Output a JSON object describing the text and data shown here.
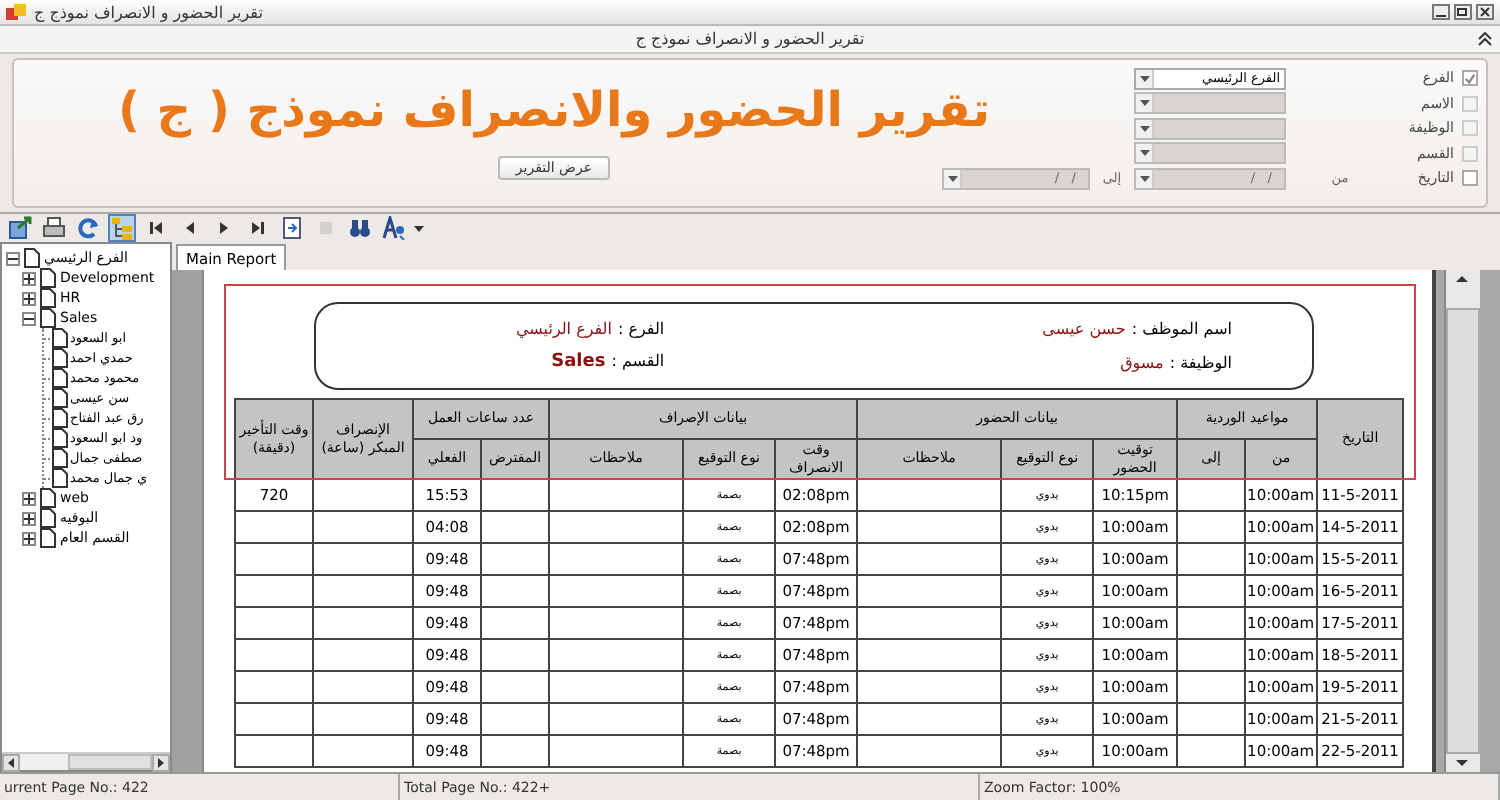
{
  "window": {
    "title": "تقرير الحضور و الانصراف نموذج ج"
  },
  "panel": {
    "title": "تقرير الحضور و الانصراف نموذج ج"
  },
  "banner": "تقرير الحضور والانصراف نموذج ( ج )",
  "filters": [
    {
      "label": "الفرع",
      "checked": true,
      "disabled": false,
      "value": "الفرع الرئيسي"
    },
    {
      "label": "الاسم",
      "checked": false,
      "disabled": true
    },
    {
      "label": "الوظيفة",
      "checked": false,
      "disabled": true
    },
    {
      "label": "القسم",
      "checked": false,
      "disabled": true
    }
  ],
  "date_filter": {
    "label": "التاريخ",
    "checked": false,
    "from_label": "من",
    "from_value": "/   /",
    "to_label": "إلى",
    "to_value": "/   /"
  },
  "show_button": "عرض التقرير",
  "toolbar": [
    {
      "kind": "export",
      "selected": false,
      "disabled": false
    },
    {
      "kind": "print",
      "selected": false,
      "disabled": false
    },
    {
      "kind": "refresh",
      "selected": false,
      "disabled": false
    },
    {
      "kind": "tree",
      "selected": true,
      "disabled": false
    },
    {
      "kind": "first",
      "selected": false,
      "disabled": false
    },
    {
      "kind": "prev",
      "selected": false,
      "disabled": false
    },
    {
      "kind": "next",
      "selected": false,
      "disabled": false
    },
    {
      "kind": "last",
      "selected": false,
      "disabled": false
    },
    {
      "kind": "goto",
      "selected": false,
      "disabled": false
    },
    {
      "kind": "stop",
      "selected": false,
      "disabled": true
    },
    {
      "kind": "search",
      "selected": false,
      "disabled": false
    },
    {
      "kind": "find",
      "selected": false,
      "disabled": false
    }
  ],
  "tree": [
    {
      "label": "الفرع الرئيسي",
      "expanded": true,
      "children": [
        {
          "label": "Development",
          "expanded": false
        },
        {
          "label": "HR",
          "expanded": false
        },
        {
          "label": "Sales",
          "expanded": true,
          "children": [
            {
              "label": "ابو السعود"
            },
            {
              "label": "حمدي احمد"
            },
            {
              "label": "محمود محمد"
            },
            {
              "label": "سن عيسى"
            },
            {
              "label": "رق عبد الفتاح"
            },
            {
              "label": "ود ابو السعود"
            },
            {
              "label": "صطفى جمال"
            },
            {
              "label": "ي جمال محمد"
            }
          ]
        },
        {
          "label": "web",
          "expanded": false
        },
        {
          "label": "البوفيه",
          "expanded": false
        },
        {
          "label": "القسم العام",
          "expanded": false
        }
      ]
    }
  ],
  "tabs": [
    {
      "label": "Main Report",
      "selected": true
    }
  ],
  "report": {
    "info_right": [
      {
        "label": "اسم الموظف :",
        "value": "حسن عيسى"
      },
      {
        "label": "الوظيفة :",
        "value": "مسوق"
      }
    ],
    "info_left": [
      {
        "label": "الفرع :",
        "value": "الفرع الرئيسي"
      },
      {
        "label": "القسم :",
        "value": "Sales"
      }
    ],
    "headers": [
      {
        "label": "التاريخ"
      },
      {
        "label": "مواعيد الوردية",
        "sub": [
          "من",
          "إلى"
        ]
      },
      {
        "label": "بيانات الحضور",
        "sub": [
          "توقيت الحضور",
          "نوع التوقيع",
          "ملاحظات"
        ]
      },
      {
        "label": "بيانات الإصراف",
        "sub": [
          "وقت الانصراف",
          "نوع التوقيع",
          "ملاحظات"
        ]
      },
      {
        "label": "عدد ساعات العمل",
        "sub": [
          "المفترض",
          "الفعلي"
        ]
      },
      {
        "label": "الإنصراف المبكر (ساعة)"
      },
      {
        "label": "وقت التأخير (دقيقة)"
      }
    ],
    "rows": [
      {
        "date": "11-5-2011",
        "shift_from": "10:00am",
        "arrival": "10:15pm",
        "arrival_type": "يدوي",
        "departure": "02:08pm",
        "departure_type": "بصمة",
        "actual_hours": "15:53",
        "late_minutes": "720"
      },
      {
        "date": "14-5-2011",
        "shift_from": "10:00am",
        "arrival": "10:00am",
        "arrival_type": "يدوي",
        "departure": "02:08pm",
        "departure_type": "بصمة",
        "actual_hours": "04:08"
      },
      {
        "date": "15-5-2011",
        "shift_from": "10:00am",
        "arrival": "10:00am",
        "arrival_type": "يدوي",
        "departure": "07:48pm",
        "departure_type": "بصمة",
        "actual_hours": "09:48"
      },
      {
        "date": "16-5-2011",
        "shift_from": "10:00am",
        "arrival": "10:00am",
        "arrival_type": "يدوي",
        "departure": "07:48pm",
        "departure_type": "بصمة",
        "actual_hours": "09:48"
      },
      {
        "date": "17-5-2011",
        "shift_from": "10:00am",
        "arrival": "10:00am",
        "arrival_type": "يدوي",
        "departure": "07:48pm",
        "departure_type": "بصمة",
        "actual_hours": "09:48"
      },
      {
        "date": "18-5-2011",
        "shift_from": "10:00am",
        "arrival": "10:00am",
        "arrival_type": "يدوي",
        "departure": "07:48pm",
        "departure_type": "بصمة",
        "actual_hours": "09:48"
      },
      {
        "date": "19-5-2011",
        "shift_from": "10:00am",
        "arrival": "10:00am",
        "arrival_type": "يدوي",
        "departure": "07:48pm",
        "departure_type": "بصمة",
        "actual_hours": "09:48"
      },
      {
        "date": "21-5-2011",
        "shift_from": "10:00am",
        "arrival": "10:00am",
        "arrival_type": "يدوي",
        "departure": "07:48pm",
        "departure_type": "بصمة",
        "actual_hours": "09:48"
      },
      {
        "date": "22-5-2011",
        "shift_from": "10:00am",
        "arrival": "10:00am",
        "arrival_type": "يدوي",
        "departure": "07:48pm",
        "departure_type": "بصمة",
        "actual_hours": "09:48"
      }
    ]
  },
  "status_bar": {
    "current_page": "urrent Page No.: 422",
    "total_pages": "Total Page No.: 422+",
    "zoom": "Zoom Factor: 100%"
  }
}
